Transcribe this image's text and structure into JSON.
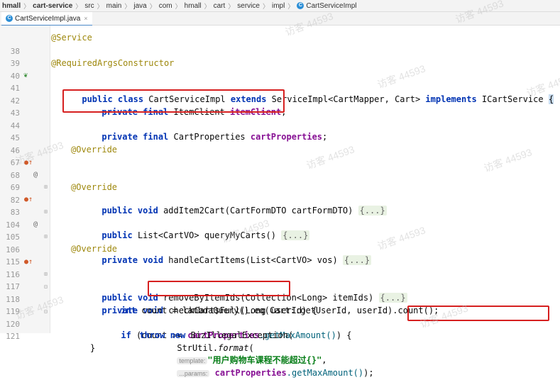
{
  "breadcrumb": [
    "hmall",
    "cart-service",
    "src",
    "main",
    "java",
    "com",
    "hmall",
    "cart",
    "service",
    "impl",
    "CartServiceImpl"
  ],
  "tab": {
    "icon": "C",
    "label": "CartServiceImpl.java",
    "close": "×"
  },
  "watermark": "访客 44593",
  "line_numbers": [
    "38",
    "39",
    "40",
    "41",
    "42",
    "43",
    "44",
    "45",
    "46",
    "67",
    "68",
    "69",
    "82",
    "83",
    "104",
    "105",
    "106",
    "115",
    "116",
    "117",
    "118",
    "119",
    "120",
    "121"
  ],
  "code": {
    "l37": "@Service",
    "l38": "@RequiredArgsConstructor",
    "l39": [
      "public class ",
      "CartServiceImpl ",
      "extends ",
      "ServiceImpl<CartMapper, Cart> ",
      "implements ",
      "ICartService ",
      "{"
    ],
    "l41": [
      "private final ",
      "ItemClient ",
      "itemClient",
      ";"
    ],
    "l43": [
      "private final ",
      "CartProperties ",
      "cartProperties",
      ";"
    ],
    "l45": "@Override",
    "l46": [
      "public void ",
      "addItem2Cart(CartFormDTO cartFormDTO) ",
      "{...}"
    ],
    "l68": "@Override",
    "l69": [
      "public ",
      "List<CartVO> queryMyCarts() ",
      "{...}"
    ],
    "l83": [
      "private void ",
      "handleCartItems(List<CartVO> vos) ",
      "{...}"
    ],
    "l105": "@Override",
    "l106": [
      "public void ",
      "removeByItemIds(Collection<Long> itemIds) ",
      "{...}"
    ],
    "l116": [
      "private void ",
      "checkCartsFull(Long userId) {"
    ],
    "l117": [
      "int ",
      "count = lambdaQuery().eq(Cart::getUserId, userId).count();"
    ],
    "l118": [
      "if ",
      "(count >= ",
      "cartProperties",
      ".getMaxAmount()",
      ") {"
    ],
    "l119": [
      "throw new ",
      "BizIllegalException("
    ],
    "l120": [
      "StrUtil.",
      "format",
      "(",
      "template:",
      "\"用户购物车课程不能超过{}\"",
      ", ",
      "...params:",
      "cartProperties",
      ".getMaxAmount()",
      ");"
    ],
    "l121": "}"
  }
}
